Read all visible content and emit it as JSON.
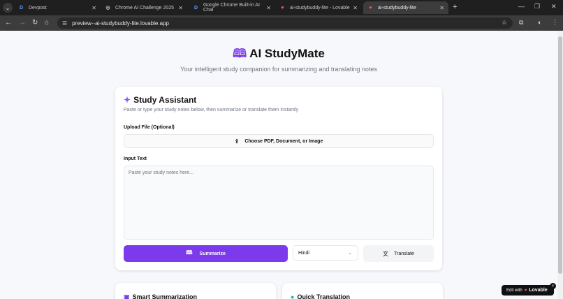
{
  "browser": {
    "tabs": [
      {
        "label": "Devpost",
        "favicon": "D",
        "icon": "devpost-icon",
        "active": false
      },
      {
        "label": "Chrome AI Challenge 2025",
        "favicon": "◎",
        "icon": "chrome-icon",
        "active": false
      },
      {
        "label": "Google Chrome Built-in AI Chal",
        "favicon": "D",
        "icon": "devpost-icon",
        "active": false
      },
      {
        "label": "ai-studybuddy-lite - Lovable",
        "favicon": "♥",
        "icon": "lovable-icon",
        "active": false
      },
      {
        "label": "ai-studybuddy-lite",
        "favicon": "♥",
        "icon": "lovable-icon",
        "active": true
      }
    ],
    "url": "preview--ai-studybuddy-lite.lovable.app"
  },
  "header": {
    "title": "AI StudyMate",
    "subtitle": "Your intelligent study companion for summarizing and translating notes"
  },
  "assistant": {
    "title": "Study Assistant",
    "subtitle": "Paste or type your study notes below, then summarize or translate them instantly",
    "upload_label": "Upload File (Optional)",
    "upload_button": "Choose PDF, Document, or Image",
    "input_label": "Input Text",
    "input_placeholder": "Paste your study notes here...",
    "summarize_button": "Summarize",
    "language_selected": "Hindi",
    "translate_button": "Translate"
  },
  "features": [
    {
      "title": "Smart Summarization"
    },
    {
      "title": "Quick Translation"
    }
  ],
  "badge": {
    "prefix": "Edit with",
    "brand": "Lovable"
  },
  "colors": {
    "accent": "#7c3aed",
    "tab_bar": "#1f1f1f",
    "toolbar": "#3c3c3c"
  }
}
